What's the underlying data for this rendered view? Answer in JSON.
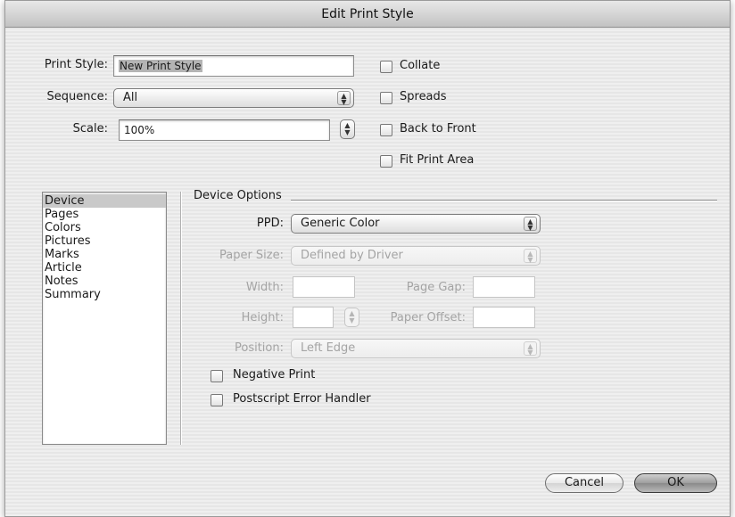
{
  "window": {
    "title": "Edit Print Style"
  },
  "top": {
    "print_style_label": "Print Style:",
    "print_style_value": "New Print Style",
    "sequence_label": "Sequence:",
    "sequence_value": "All",
    "scale_label": "Scale:",
    "scale_value": "100%"
  },
  "checkboxes": {
    "collate": {
      "label": "Collate",
      "checked": false
    },
    "spreads": {
      "label": "Spreads",
      "checked": false
    },
    "back_to_front": {
      "label": "Back to Front",
      "checked": false
    },
    "fit_print_area": {
      "label": "Fit Print Area",
      "checked": false
    }
  },
  "sidebar": {
    "items": [
      {
        "label": "Device",
        "selected": true
      },
      {
        "label": "Pages"
      },
      {
        "label": "Colors"
      },
      {
        "label": "Pictures"
      },
      {
        "label": "Marks"
      },
      {
        "label": "Article"
      },
      {
        "label": "Notes"
      },
      {
        "label": "Summary"
      }
    ]
  },
  "device": {
    "group_title": "Device Options",
    "ppd_label": "PPD:",
    "ppd_value": "Generic Color",
    "paper_size_label": "Paper Size:",
    "paper_size_value": "Defined by Driver",
    "width_label": "Width:",
    "width_value": "",
    "page_gap_label": "Page Gap:",
    "page_gap_value": "",
    "height_label": "Height:",
    "height_value": "",
    "paper_offset_label": "Paper Offset:",
    "paper_offset_value": "",
    "position_label": "Position:",
    "position_value": "Left Edge",
    "negative_print": {
      "label": "Negative Print",
      "checked": false
    },
    "postscript_error_handler": {
      "label": "Postscript Error Handler",
      "checked": false
    }
  },
  "buttons": {
    "cancel": "Cancel",
    "ok": "OK"
  },
  "colors": {
    "window_bg": "#ececec",
    "selection": "#c9c9c9",
    "disabled_text": "#a4a4a4"
  },
  "icons": {
    "popup_arrows": "up-down-arrows-icon",
    "stepper": "stepper-arrows-icon"
  }
}
